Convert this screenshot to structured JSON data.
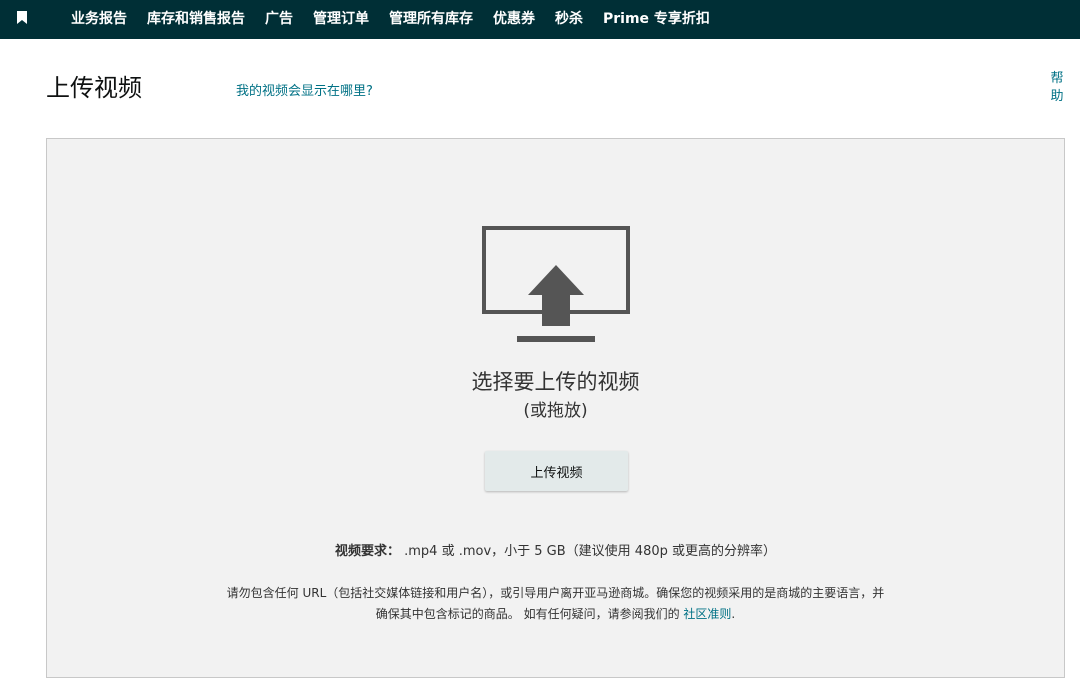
{
  "nav": {
    "items": [
      "业务报告",
      "库存和销售报告",
      "广告",
      "管理订单",
      "管理所有库存",
      "优惠券",
      "秒杀",
      "Prime 专享折扣"
    ]
  },
  "header": {
    "title": "上传视频",
    "where_link": "我的视频会显示在哪里?",
    "help_link": "帮助"
  },
  "upload": {
    "choose_text": "选择要上传的视频",
    "drag_text": "(或拖放)",
    "button_label": "上传视频",
    "requirements_label": "视频要求：",
    "requirements_text": " .mp4 或 .mov，小于 5 GB（建议使用 480p 或更高的分辨率）",
    "guidelines_line1": "请勿包含任何 URL（包括社交媒体链接和用户名），或引导用户离开亚马逊商城。确保您的视频采用的是商城的主要语言，并",
    "guidelines_line2": "确保其中包含标记的商品。 如有任何疑问，请参阅我们的 ",
    "guidelines_link": "社区准则",
    "guidelines_end": "."
  },
  "colors": {
    "nav_bg": "#002f36",
    "link": "#007185",
    "panel_bg": "#f2f2f2",
    "icon": "#555555"
  },
  "icons": {
    "nav": "bookmark-icon",
    "upload": "monitor-upload-icon"
  }
}
